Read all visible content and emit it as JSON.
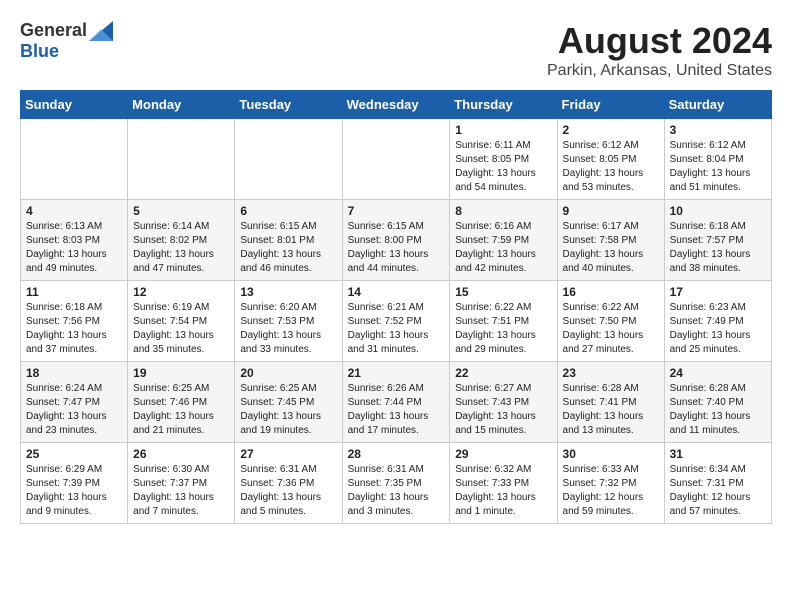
{
  "header": {
    "logo_general": "General",
    "logo_blue": "Blue",
    "month_year": "August 2024",
    "location": "Parkin, Arkansas, United States"
  },
  "weekdays": [
    "Sunday",
    "Monday",
    "Tuesday",
    "Wednesday",
    "Thursday",
    "Friday",
    "Saturday"
  ],
  "weeks": [
    [
      {
        "day": "",
        "info": ""
      },
      {
        "day": "",
        "info": ""
      },
      {
        "day": "",
        "info": ""
      },
      {
        "day": "",
        "info": ""
      },
      {
        "day": "1",
        "info": "Sunrise: 6:11 AM\nSunset: 8:05 PM\nDaylight: 13 hours\nand 54 minutes."
      },
      {
        "day": "2",
        "info": "Sunrise: 6:12 AM\nSunset: 8:05 PM\nDaylight: 13 hours\nand 53 minutes."
      },
      {
        "day": "3",
        "info": "Sunrise: 6:12 AM\nSunset: 8:04 PM\nDaylight: 13 hours\nand 51 minutes."
      }
    ],
    [
      {
        "day": "4",
        "info": "Sunrise: 6:13 AM\nSunset: 8:03 PM\nDaylight: 13 hours\nand 49 minutes."
      },
      {
        "day": "5",
        "info": "Sunrise: 6:14 AM\nSunset: 8:02 PM\nDaylight: 13 hours\nand 47 minutes."
      },
      {
        "day": "6",
        "info": "Sunrise: 6:15 AM\nSunset: 8:01 PM\nDaylight: 13 hours\nand 46 minutes."
      },
      {
        "day": "7",
        "info": "Sunrise: 6:15 AM\nSunset: 8:00 PM\nDaylight: 13 hours\nand 44 minutes."
      },
      {
        "day": "8",
        "info": "Sunrise: 6:16 AM\nSunset: 7:59 PM\nDaylight: 13 hours\nand 42 minutes."
      },
      {
        "day": "9",
        "info": "Sunrise: 6:17 AM\nSunset: 7:58 PM\nDaylight: 13 hours\nand 40 minutes."
      },
      {
        "day": "10",
        "info": "Sunrise: 6:18 AM\nSunset: 7:57 PM\nDaylight: 13 hours\nand 38 minutes."
      }
    ],
    [
      {
        "day": "11",
        "info": "Sunrise: 6:18 AM\nSunset: 7:56 PM\nDaylight: 13 hours\nand 37 minutes."
      },
      {
        "day": "12",
        "info": "Sunrise: 6:19 AM\nSunset: 7:54 PM\nDaylight: 13 hours\nand 35 minutes."
      },
      {
        "day": "13",
        "info": "Sunrise: 6:20 AM\nSunset: 7:53 PM\nDaylight: 13 hours\nand 33 minutes."
      },
      {
        "day": "14",
        "info": "Sunrise: 6:21 AM\nSunset: 7:52 PM\nDaylight: 13 hours\nand 31 minutes."
      },
      {
        "day": "15",
        "info": "Sunrise: 6:22 AM\nSunset: 7:51 PM\nDaylight: 13 hours\nand 29 minutes."
      },
      {
        "day": "16",
        "info": "Sunrise: 6:22 AM\nSunset: 7:50 PM\nDaylight: 13 hours\nand 27 minutes."
      },
      {
        "day": "17",
        "info": "Sunrise: 6:23 AM\nSunset: 7:49 PM\nDaylight: 13 hours\nand 25 minutes."
      }
    ],
    [
      {
        "day": "18",
        "info": "Sunrise: 6:24 AM\nSunset: 7:47 PM\nDaylight: 13 hours\nand 23 minutes."
      },
      {
        "day": "19",
        "info": "Sunrise: 6:25 AM\nSunset: 7:46 PM\nDaylight: 13 hours\nand 21 minutes."
      },
      {
        "day": "20",
        "info": "Sunrise: 6:25 AM\nSunset: 7:45 PM\nDaylight: 13 hours\nand 19 minutes."
      },
      {
        "day": "21",
        "info": "Sunrise: 6:26 AM\nSunset: 7:44 PM\nDaylight: 13 hours\nand 17 minutes."
      },
      {
        "day": "22",
        "info": "Sunrise: 6:27 AM\nSunset: 7:43 PM\nDaylight: 13 hours\nand 15 minutes."
      },
      {
        "day": "23",
        "info": "Sunrise: 6:28 AM\nSunset: 7:41 PM\nDaylight: 13 hours\nand 13 minutes."
      },
      {
        "day": "24",
        "info": "Sunrise: 6:28 AM\nSunset: 7:40 PM\nDaylight: 13 hours\nand 11 minutes."
      }
    ],
    [
      {
        "day": "25",
        "info": "Sunrise: 6:29 AM\nSunset: 7:39 PM\nDaylight: 13 hours\nand 9 minutes."
      },
      {
        "day": "26",
        "info": "Sunrise: 6:30 AM\nSunset: 7:37 PM\nDaylight: 13 hours\nand 7 minutes."
      },
      {
        "day": "27",
        "info": "Sunrise: 6:31 AM\nSunset: 7:36 PM\nDaylight: 13 hours\nand 5 minutes."
      },
      {
        "day": "28",
        "info": "Sunrise: 6:31 AM\nSunset: 7:35 PM\nDaylight: 13 hours\nand 3 minutes."
      },
      {
        "day": "29",
        "info": "Sunrise: 6:32 AM\nSunset: 7:33 PM\nDaylight: 13 hours\nand 1 minute."
      },
      {
        "day": "30",
        "info": "Sunrise: 6:33 AM\nSunset: 7:32 PM\nDaylight: 12 hours\nand 59 minutes."
      },
      {
        "day": "31",
        "info": "Sunrise: 6:34 AM\nSunset: 7:31 PM\nDaylight: 12 hours\nand 57 minutes."
      }
    ]
  ]
}
